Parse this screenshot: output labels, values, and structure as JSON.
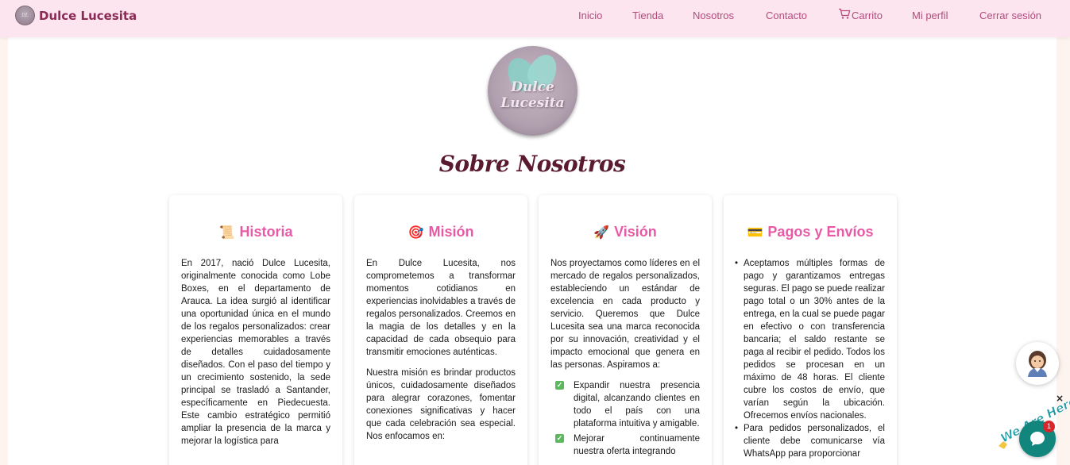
{
  "brand": {
    "name": "Dulce Lucesita",
    "logo_text": "DL"
  },
  "nav": {
    "inicio": "Inicio",
    "tienda": "Tienda",
    "nosotros": "Nosotros",
    "contacto": "Contacto",
    "carrito": "Carrito",
    "perfil": "Mi perfil",
    "logout": "Cerrar sesión"
  },
  "hero": {
    "logo_line1": "Dulce",
    "logo_line2": "Lucesita",
    "title": "Sobre Nosotros"
  },
  "cards": [
    {
      "icon": "📜",
      "title": "Historia",
      "paragraphs": [
        "En 2017, nació Dulce Lucesita, originalmente conocida como Lobe Boxes, en el departamento de Arauca. La idea surgió al identificar una oportunidad única en el mundo de los regalos personalizados: crear experiencias memorables a través de detalles cuidadosamente diseñados. Con el paso del tiempo y un crecimiento sostenido, la sede principal se trasladó a Santander, específicamente en Piedecuesta. Este cambio estratégico permitió ampliar la presencia de la marca y mejorar la logística para"
      ]
    },
    {
      "icon": "🎯",
      "title": "Misión",
      "paragraphs": [
        "En Dulce Lucesita, nos comprometemos a transformar momentos cotidianos en experiencias inolvidables a través de regalos personalizados. Creemos en la magia de los detalles y en la capacidad de cada obsequio para transmitir emociones auténticas.",
        "Nuestra misión es brindar productos únicos, cuidadosamente diseñados para alegrar corazones, fomentar conexiones significativas y hacer que cada celebración sea especial. Nos enfocamos en:"
      ]
    },
    {
      "icon": "🚀",
      "title": "Visión",
      "paragraphs": [
        "Nos proyectamos como líderes en el mercado de regalos personalizados, estableciendo un estándar de excelencia en cada producto y servicio. Queremos que Dulce Lucesita sea una marca reconocida por su innovación, creatividad y el impacto emocional que genera en las personas. Aspiramos a:"
      ],
      "checks": [
        "Expandir nuestra presencia digital, alcanzando clientes en todo el país con una plataforma intuitiva y amigable.",
        "Mejorar continuamente nuestra oferta integrando"
      ]
    },
    {
      "icon": "💳",
      "title": "Pagos y Envíos",
      "bullets": [
        "Aceptamos múltiples formas de pago y garantizamos entregas seguras. El pago se puede realizar pago total o un 30% antes de la entrega, en la cual se puede pagar en efectivo o con transferencia bancaria; el saldo restante se paga al recibir el pedido. Todos los pedidos se procesan en un máximo de 48 horas. El cliente cubre los costos de envío, que varían según la ubicación. Ofrecemos envíos nacionales.",
        "Para pedidos personalizados, el cliente debe comunicarse vía WhatsApp para proporcionar"
      ]
    }
  ],
  "chat": {
    "we_are_here": "We Are Here!",
    "badge_count": "1",
    "close": "×"
  }
}
